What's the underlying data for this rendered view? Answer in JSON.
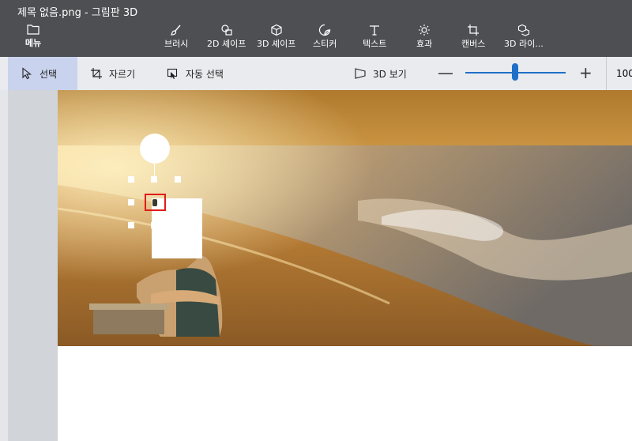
{
  "window": {
    "title": "제목 없음.png - 그림판 3D"
  },
  "ribbon": {
    "menu_label": "메뉴",
    "tools": [
      {
        "label": "브러시",
        "icon": "brush-icon"
      },
      {
        "label": "2D 셰이프",
        "icon": "2d-shapes-icon"
      },
      {
        "label": "3D 셰이프",
        "icon": "3d-shapes-icon"
      },
      {
        "label": "스티커",
        "icon": "sticker-icon"
      },
      {
        "label": "텍스트",
        "icon": "text-icon"
      },
      {
        "label": "효과",
        "icon": "effects-icon"
      },
      {
        "label": "캔버스",
        "icon": "canvas-icon"
      },
      {
        "label": "3D 라이...",
        "icon": "3d-library-icon"
      }
    ]
  },
  "commandbar": {
    "select_label": "선택",
    "crop_label": "자르기",
    "magic_select_label": "자동 선택",
    "view3d_label": "3D 보기",
    "zoom_minus": "—",
    "zoom_plus": "+",
    "zoom_level": 0.5,
    "zoom_readout": "100"
  },
  "colors": {
    "ribbon_bg": "#4d4f53",
    "cmdbar_bg": "#e9ebee",
    "accent": "#1e6fc8",
    "selection_highlight": "#c9d3ee",
    "marker": "#e01b1b"
  }
}
